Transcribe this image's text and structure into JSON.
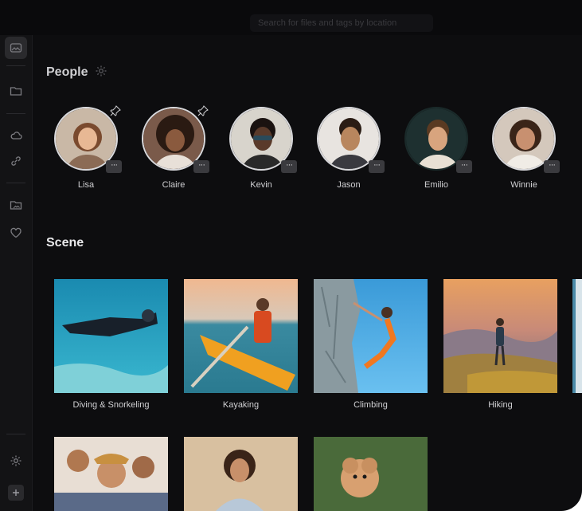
{
  "search": {
    "placeholder": "Search for files and tags by location"
  },
  "people_section": {
    "title": "People",
    "people": [
      {
        "name": "Lisa",
        "pinned": true
      },
      {
        "name": "Claire",
        "pinned": true
      },
      {
        "name": "Kevin",
        "pinned": false
      },
      {
        "name": "Jason",
        "pinned": false
      },
      {
        "name": "Emilio",
        "pinned": false
      },
      {
        "name": "Winnie",
        "pinned": false
      }
    ],
    "more_label": "···"
  },
  "scene_section": {
    "title": "Scene",
    "scenes": [
      {
        "label": "Diving & Snorkeling"
      },
      {
        "label": "Kayaking"
      },
      {
        "label": "Climbing"
      },
      {
        "label": "Hiking"
      }
    ]
  },
  "sidebar": {
    "items": [
      {
        "icon": "photos-icon",
        "active": true
      },
      {
        "icon": "folder-icon"
      },
      {
        "icon": "cloud-icon"
      },
      {
        "icon": "link-icon"
      },
      {
        "icon": "folder-image-icon"
      },
      {
        "icon": "heart-icon"
      },
      {
        "icon": "gear-icon"
      },
      {
        "icon": "plus-icon"
      }
    ]
  },
  "colors": {
    "background": "#0d0d0f",
    "sidebar": "#131315",
    "text": "#d0d0d3"
  }
}
